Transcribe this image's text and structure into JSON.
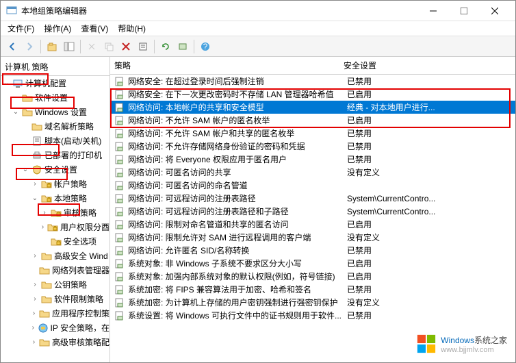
{
  "window": {
    "title": "本地组策略编辑器"
  },
  "menu": {
    "file": "文件(F)",
    "action": "操作(A)",
    "view": "查看(V)",
    "help": "帮助(H)"
  },
  "tree": {
    "header": "计算机 策略",
    "nodes": [
      {
        "indent": 0,
        "exp": "v",
        "icon": "computer",
        "label": "计算机配置"
      },
      {
        "indent": 1,
        "exp": "",
        "icon": "folder",
        "label": "软件设置"
      },
      {
        "indent": 1,
        "exp": "v",
        "icon": "folder",
        "label": "Windows 设置"
      },
      {
        "indent": 2,
        "exp": "",
        "icon": "folder",
        "label": "域名解析策略"
      },
      {
        "indent": 2,
        "exp": "",
        "icon": "script",
        "label": "脚本(启动/关机)"
      },
      {
        "indent": 2,
        "exp": "",
        "icon": "printer",
        "label": "已部署的打印机"
      },
      {
        "indent": 2,
        "exp": "v",
        "icon": "security",
        "label": "安全设置"
      },
      {
        "indent": 3,
        "exp": ">",
        "icon": "folder-lock",
        "label": "帐户策略"
      },
      {
        "indent": 3,
        "exp": "v",
        "icon": "folder-lock",
        "label": "本地策略"
      },
      {
        "indent": 4,
        "exp": ">",
        "icon": "folder-lock",
        "label": "审核策略"
      },
      {
        "indent": 4,
        "exp": ">",
        "icon": "folder-lock",
        "label": "用户权限分酉"
      },
      {
        "indent": 4,
        "exp": "",
        "icon": "folder-lock",
        "label": "安全选项"
      },
      {
        "indent": 3,
        "exp": ">",
        "icon": "folder",
        "label": "高级安全 Wind"
      },
      {
        "indent": 3,
        "exp": "",
        "icon": "folder",
        "label": "网络列表管理器"
      },
      {
        "indent": 3,
        "exp": ">",
        "icon": "folder",
        "label": "公钥策略"
      },
      {
        "indent": 3,
        "exp": ">",
        "icon": "folder",
        "label": "软件限制策略"
      },
      {
        "indent": 3,
        "exp": ">",
        "icon": "folder",
        "label": "应用程序控制策"
      },
      {
        "indent": 3,
        "exp": ">",
        "icon": "ip",
        "label": "IP 安全策略，在"
      },
      {
        "indent": 3,
        "exp": ">",
        "icon": "folder",
        "label": "高级审核策略配"
      }
    ]
  },
  "list": {
    "col_policy": "策略",
    "col_setting": "安全设置",
    "rows": [
      {
        "policy": "网络安全: 在超过登录时间后强制注销",
        "setting": "已禁用",
        "selected": false
      },
      {
        "policy": "网络安全: 在下一次更改密码时不存储 LAN 管理器哈希值",
        "setting": "已启用",
        "selected": false
      },
      {
        "policy": "网络访问: 本地帐户的共享和安全模型",
        "setting": "经典 - 对本地用户进行...",
        "selected": true
      },
      {
        "policy": "网络访问: 不允许 SAM 帐户的匿名枚举",
        "setting": "已启用",
        "selected": false
      },
      {
        "policy": "网络访问: 不允许 SAM 帐户和共享的匿名枚举",
        "setting": "已禁用",
        "selected": false
      },
      {
        "policy": "网络访问: 不允许存储网络身份验证的密码和凭据",
        "setting": "已禁用",
        "selected": false
      },
      {
        "policy": "网络访问: 将 Everyone 权限应用于匿名用户",
        "setting": "已禁用",
        "selected": false
      },
      {
        "policy": "网络访问: 可匿名访问的共享",
        "setting": "没有定义",
        "selected": false
      },
      {
        "policy": "网络访问: 可匿名访问的命名管道",
        "setting": "",
        "selected": false
      },
      {
        "policy": "网络访问: 可远程访问的注册表路径",
        "setting": "System\\CurrentContro...",
        "selected": false
      },
      {
        "policy": "网络访问: 可远程访问的注册表路径和子路径",
        "setting": "System\\CurrentContro...",
        "selected": false
      },
      {
        "policy": "网络访问: 限制对命名管道和共享的匿名访问",
        "setting": "已启用",
        "selected": false
      },
      {
        "policy": "网络访问: 限制允许对 SAM 进行远程调用的客户端",
        "setting": "没有定义",
        "selected": false
      },
      {
        "policy": "网络访问: 允许匿名 SID/名称转换",
        "setting": "已禁用",
        "selected": false
      },
      {
        "policy": "系统对象: 非 Windows 子系统不要求区分大小写",
        "setting": "已启用",
        "selected": false
      },
      {
        "policy": "系统对象: 加强内部系统对象的默认权限(例如，符号链接)",
        "setting": "已启用",
        "selected": false
      },
      {
        "policy": "系统加密: 将 FIPS 兼容算法用于加密、哈希和签名",
        "setting": "已禁用",
        "selected": false
      },
      {
        "policy": "系统加密: 为计算机上存储的用户密钥强制进行强密钥保护",
        "setting": "没有定义",
        "selected": false
      },
      {
        "policy": "系统设置: 将 Windows 可执行文件中的证书规则用于软件...",
        "setting": "已禁用",
        "selected": false
      }
    ]
  },
  "watermark": {
    "brand": "Windows",
    "suffix": "系统之家",
    "url": "www.bjjmlv.com"
  }
}
